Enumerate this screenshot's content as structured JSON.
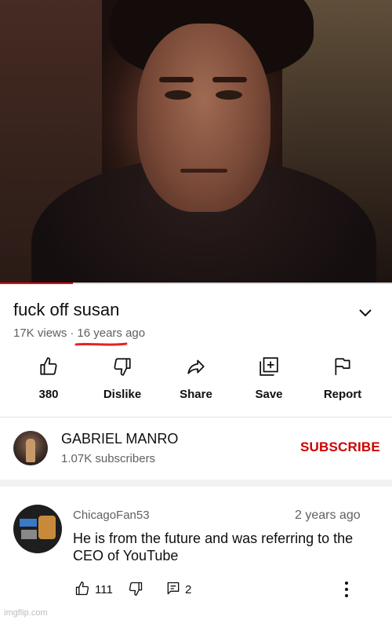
{
  "player": {
    "progress_percent": 18.6,
    "progress_color": "#ff0000"
  },
  "video": {
    "title": "fuck off susan",
    "views": "17K views",
    "separator": "·",
    "age": "16 years ago",
    "age_underline_color": "#e52222"
  },
  "actions": {
    "like_label": "380",
    "dislike_label": "Dislike",
    "share_label": "Share",
    "save_label": "Save",
    "report_label": "Report"
  },
  "channel": {
    "name": "GABRIEL MANRO",
    "subscribers": "1.07K subscribers",
    "subscribe_label": "SUBSCRIBE",
    "subscribe_color": "#cc0000"
  },
  "comment": {
    "author": "ChicagoFan53",
    "time": "2 years ago",
    "text": "He is from the future and was referring to the CEO of YouTube",
    "likes": "111",
    "replies": "2"
  },
  "watermark": "imgflip.com",
  "icons": [
    "chevron-down-icon",
    "like-icon",
    "dislike-icon",
    "share-icon",
    "save-icon",
    "report-flag-icon",
    "reply-icon",
    "more-vert-icon"
  ]
}
